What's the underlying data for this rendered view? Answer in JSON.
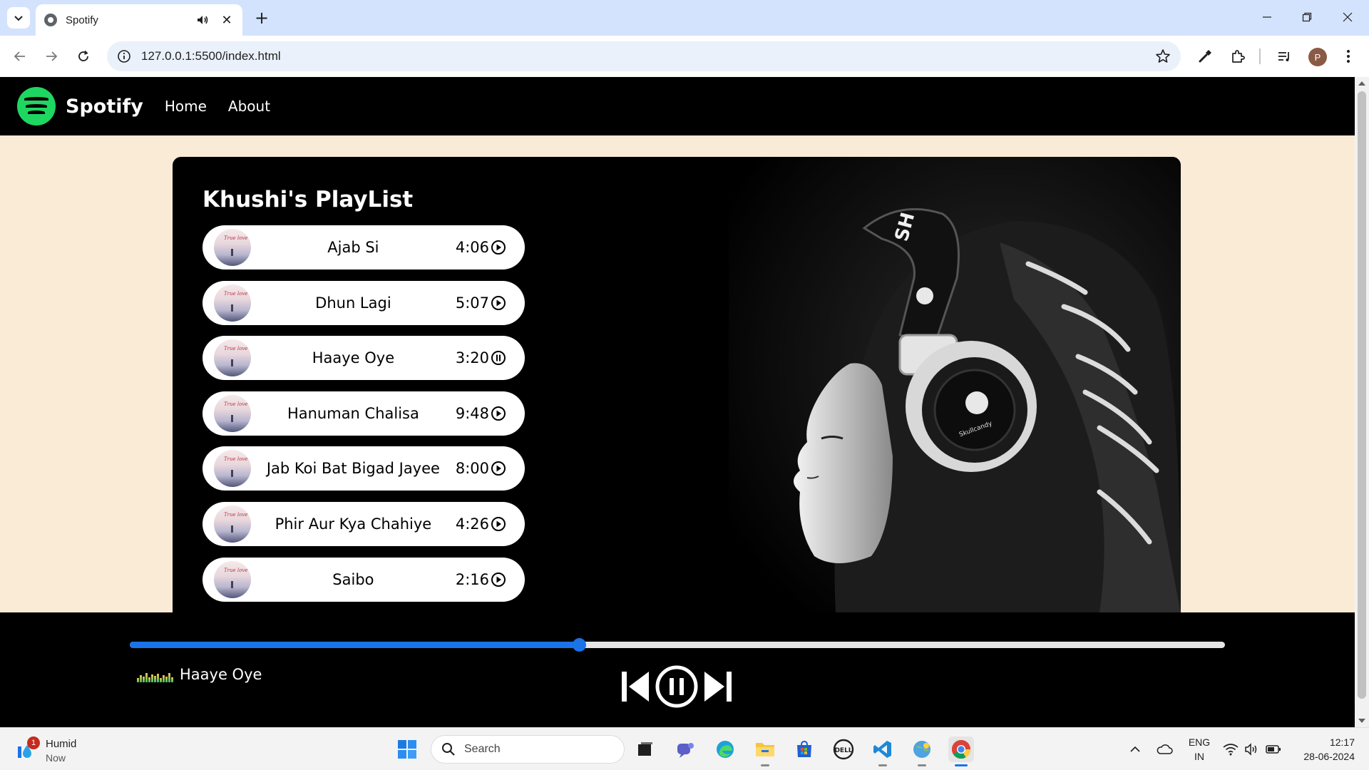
{
  "browser": {
    "tab_title": "Spotify",
    "new_tab": "+",
    "url": "127.0.0.1:5500/index.html",
    "profile_initial": "P"
  },
  "site": {
    "brand": "Spotify",
    "nav_links": [
      "Home",
      "About"
    ],
    "playlist_title": "Khushi's PlayList",
    "cover_caption": "True love",
    "songs": [
      {
        "name": "Ajab Si",
        "duration": "4:06",
        "state": "play"
      },
      {
        "name": "Dhun Lagi",
        "duration": "5:07",
        "state": "play"
      },
      {
        "name": "Haaye Oye",
        "duration": "3:20",
        "state": "pause"
      },
      {
        "name": "Hanuman Chalisa",
        "duration": "9:48",
        "state": "play"
      },
      {
        "name": "Jab Koi Bat Bigad Jayee",
        "duration": "8:00",
        "state": "play"
      },
      {
        "name": "Phir Aur Kya Chahiye",
        "duration": "4:26",
        "state": "play"
      },
      {
        "name": "Saibo",
        "duration": "2:16",
        "state": "play"
      }
    ]
  },
  "player": {
    "now_playing": "Haaye Oye",
    "progress_fraction": 0.41,
    "accent_color": "#1a73e8",
    "state": "playing"
  },
  "taskbar": {
    "weather_title": "Humid",
    "weather_sub": "Now",
    "notification_count": "1",
    "search_placeholder": "Search",
    "lang_line1": "ENG",
    "lang_line2": "IN",
    "time": "12:17",
    "date": "28-06-2024"
  },
  "icons": [
    "tab-search-icon",
    "speaker-icon",
    "close-icon",
    "minimize-icon",
    "restore-icon",
    "back-icon",
    "forward-icon",
    "reload-icon",
    "site-info-icon",
    "bookmark-star-icon",
    "eyedropper-icon",
    "extensions-icon",
    "media-control-icon",
    "menu-icon"
  ]
}
